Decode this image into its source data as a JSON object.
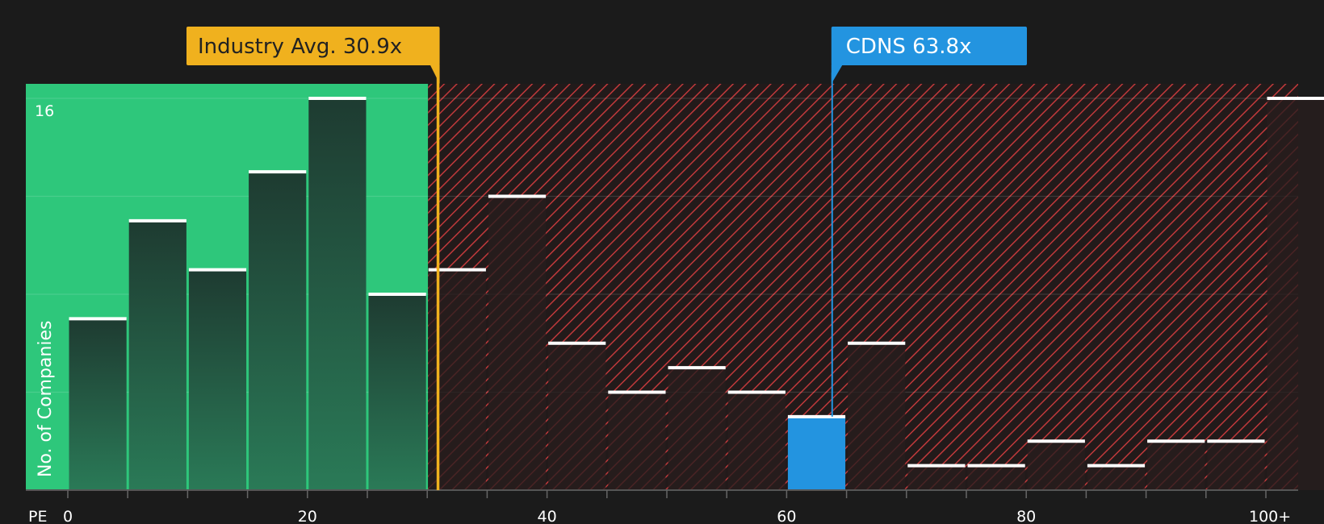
{
  "chart_data": {
    "type": "bar",
    "x_label": "PE",
    "y_label": "No. of Companies",
    "y_tick_label": "16",
    "y_max": 16,
    "x_ticks": [
      {
        "value": 0,
        "label": "0"
      },
      {
        "value": 20,
        "label": "20"
      },
      {
        "value": 40,
        "label": "40"
      },
      {
        "value": 60,
        "label": "60"
      },
      {
        "value": 80,
        "label": "80"
      },
      {
        "value": 100,
        "label": "100+"
      }
    ],
    "bins": [
      {
        "start": 0,
        "end": 5,
        "count": 7
      },
      {
        "start": 5,
        "end": 10,
        "count": 11
      },
      {
        "start": 10,
        "end": 15,
        "count": 9
      },
      {
        "start": 15,
        "end": 20,
        "count": 13
      },
      {
        "start": 20,
        "end": 25,
        "count": 16
      },
      {
        "start": 25,
        "end": 30,
        "count": 8
      },
      {
        "start": 30,
        "end": 35,
        "count": 9
      },
      {
        "start": 35,
        "end": 40,
        "count": 12
      },
      {
        "start": 40,
        "end": 45,
        "count": 6
      },
      {
        "start": 45,
        "end": 50,
        "count": 4
      },
      {
        "start": 50,
        "end": 55,
        "count": 5
      },
      {
        "start": 55,
        "end": 60,
        "count": 4
      },
      {
        "start": 60,
        "end": 65,
        "count": 3,
        "highlight": true
      },
      {
        "start": 65,
        "end": 70,
        "count": 6
      },
      {
        "start": 70,
        "end": 75,
        "count": 1
      },
      {
        "start": 75,
        "end": 80,
        "count": 1
      },
      {
        "start": 80,
        "end": 85,
        "count": 2
      },
      {
        "start": 85,
        "end": 90,
        "count": 1
      },
      {
        "start": 90,
        "end": 95,
        "count": 2
      },
      {
        "start": 95,
        "end": 100,
        "count": 2
      },
      {
        "start": 100,
        "end": 105,
        "count": 16
      }
    ],
    "industry_avg": {
      "value": 30.9,
      "label": "Industry Avg. 30.9x"
    },
    "company": {
      "value": 63.8,
      "label": "CDNS 63.8x"
    },
    "colors": {
      "background": "#1b1b1b",
      "fair_zone": "#2ec77b",
      "fair_bar_top": "#1f3f33",
      "fair_bar_bottom": "#2a7a57",
      "over_zone_hatch": "#c0393b",
      "over_bar": "#3a2323",
      "highlight_bar": "#2394e0",
      "industry": "#f0b11e",
      "company": "#2394e0",
      "bar_cap": "#ffffff"
    }
  }
}
